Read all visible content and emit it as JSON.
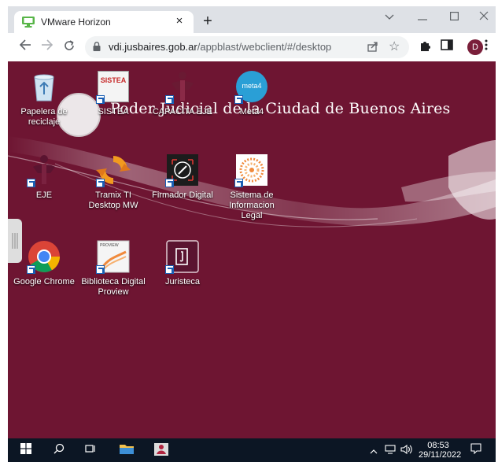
{
  "browser": {
    "tab_title": "VMware Horizon",
    "tab_close": "×",
    "new_tab": "+",
    "url_host": "vdi.jusbaires.gob.ar",
    "url_path": "/appblast/webclient/#/desktop",
    "profile_initial": "D"
  },
  "desktop": {
    "banner": "Poder Judicial de la Ciudad de Buenos Aires",
    "icons": [
      {
        "label": "Papelera de reciclaje",
        "icon": "recycle-bin-icon"
      },
      {
        "label": "SISTEA",
        "icon": "sistea-icon",
        "art_text": "SISTEA"
      },
      {
        "label": "CAPACITA EJE",
        "icon": "capacita-eje-icon"
      },
      {
        "label": "Meta4",
        "icon": "meta4-icon",
        "art_text": "meta4"
      },
      {
        "label": "EJE",
        "icon": "eje-icon"
      },
      {
        "label": "Tramix TI Desktop MW",
        "icon": "tramix-icon"
      },
      {
        "label": "Firmador Digital",
        "icon": "firmador-digital-icon"
      },
      {
        "label": "Sistema de Informacion Legal",
        "icon": "sistema-informacion-legal-icon"
      },
      {
        "label": "Google Chrome",
        "icon": "chrome-icon"
      },
      {
        "label": "Biblioteca Digital Proview",
        "icon": "proview-icon",
        "art_text": "PROVIEW"
      },
      {
        "label": "Juristeca",
        "icon": "juristeca-icon"
      }
    ]
  },
  "taskbar": {
    "time": "08:53",
    "date": "29/11/2022"
  },
  "colors": {
    "desktop_bg": "#6e1532",
    "taskbar_bg": "#0c1624",
    "chrome_frame": "#dee1e6"
  }
}
